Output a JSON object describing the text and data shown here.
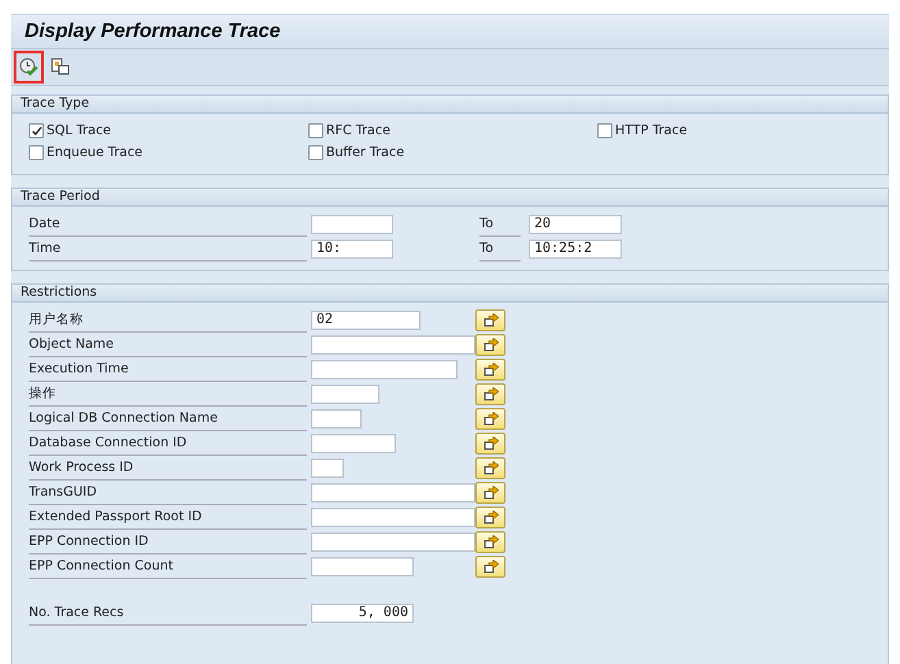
{
  "window": {
    "title": "Display Performance Trace"
  },
  "toolbar": [
    {
      "kind": "execute",
      "highlighted": true
    },
    {
      "kind": "copy",
      "highlighted": false
    }
  ],
  "trace_type": {
    "title": "Trace Type",
    "options": [
      {
        "label": "SQL Trace",
        "checked": true
      },
      {
        "label": "RFC Trace",
        "checked": false
      },
      {
        "label": "HTTP Trace",
        "checked": false
      },
      {
        "label": "Enqueue Trace",
        "checked": false
      },
      {
        "label": "Buffer Trace",
        "checked": false
      }
    ]
  },
  "trace_period": {
    "title": "Trace Period",
    "rows": [
      {
        "label": "Date",
        "to_label": "To",
        "to": "20"
      },
      {
        "label": "Time",
        "from": "10:",
        "to_label": "To",
        "to": "10:25:2"
      }
    ]
  },
  "restrictions": {
    "title": "Restrictions",
    "fields": [
      {
        "label": "用户名称",
        "value": "02"
      },
      {
        "label": "Object Name"
      },
      {
        "label": "Execution Time"
      },
      {
        "label": "操作"
      },
      {
        "label": "Logical DB Connection Name"
      },
      {
        "label": "Database Connection ID"
      },
      {
        "label": "Work Process ID"
      },
      {
        "label": "TransGUID"
      },
      {
        "label": "Extended Passport Root ID"
      },
      {
        "label": "EPP Connection ID"
      },
      {
        "label": "EPP Connection Count"
      }
    ],
    "trace_recs": {
      "label": "No. Trace Recs",
      "value": "5, 000"
    }
  }
}
